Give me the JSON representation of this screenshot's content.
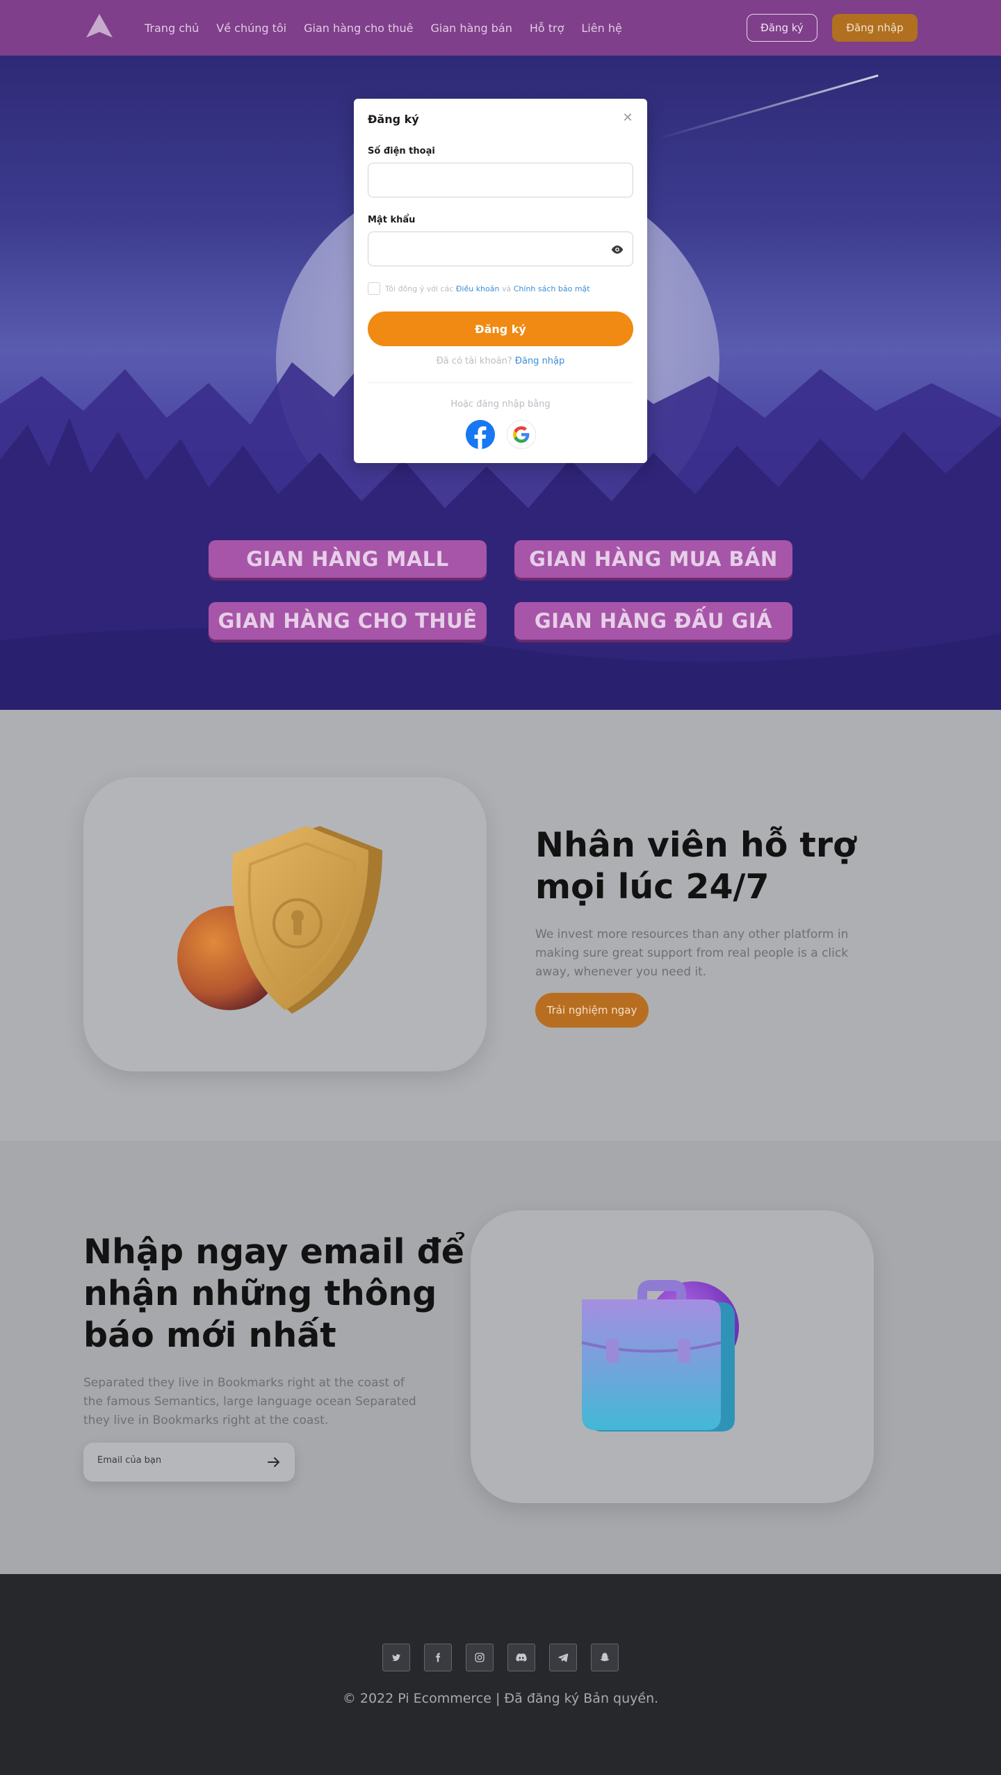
{
  "nav": {
    "links": [
      "Trang chủ",
      "Về chúng tôi",
      "Gian hàng cho thuê",
      "Gian hàng bán",
      "Hỗ trợ",
      "Liên hệ"
    ],
    "register": "Đăng ký",
    "login": "Đăng nhập"
  },
  "hero": {
    "buttons": [
      "GIAN HÀNG MALL",
      "GIAN HÀNG MUA BÁN",
      "GIAN HÀNG CHO THUÊ",
      "GIAN HÀNG ĐẤU GIÁ"
    ]
  },
  "modal": {
    "title": "Đăng ký",
    "phone_label": "Số điện thoại",
    "password_label": "Mật khẩu",
    "agree_prefix": "Tôi đồng ý với các",
    "terms": "Điều khoản",
    "and": "và",
    "privacy": "Chính sách bảo mật",
    "submit": "Đăng ký",
    "have_account": "Đã có tài khoản?",
    "login_link": "Đăng nhập",
    "or_login": "Hoặc đăng nhập bằng"
  },
  "support": {
    "title_line1": "Nhân viên hỗ trợ",
    "title_line2": "mọi lúc 24/7",
    "body": "We invest more resources than any other platform in making sure great support from real people is a click away, whenever you need it.",
    "cta": "Trải nghiệm ngay"
  },
  "newsletter": {
    "title_line1": "Nhập ngay email để",
    "title_line2": "nhận những thông",
    "title_line3": "báo mới nhất",
    "body": "Separated they live in Bookmarks right at the coast of the famous Semantics, large language ocean Separated they live in Bookmarks right at the coast.",
    "placeholder": "Email của bạn"
  },
  "footer": {
    "social": [
      "twitter-icon",
      "facebook-icon",
      "instagram-icon",
      "discord-icon",
      "telegram-icon",
      "snapchat-icon"
    ],
    "copyright": "© 2022 Pi Ecommerce | Đã đăng ký Bản quyền."
  },
  "colors": {
    "nav": "#7f3f8a",
    "accent": "#f08a12",
    "hero_button": "#a755a8",
    "footer": "#27282c"
  }
}
